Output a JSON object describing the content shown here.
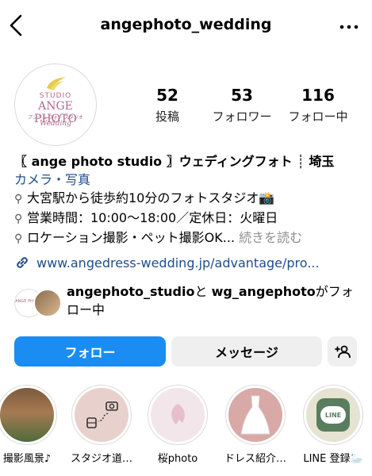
{
  "header": {
    "username": "angephoto_wedding"
  },
  "avatar": {
    "studio": "STUDIO",
    "ange": "ANGE PHOTO",
    "sub": "アンジェ フォト スタジオ",
    "wedding": "Wedding"
  },
  "stats": [
    {
      "value": "52",
      "label": "投稿"
    },
    {
      "value": "53",
      "label": "フォロワー"
    },
    {
      "value": "116",
      "label": "フォロー中"
    }
  ],
  "bio": {
    "line1_name": "〖 ange photo studio 〗ウェディングフォト ┊ 埼玉",
    "category": "カメラ・写真",
    "line2": "大宮駅から徒歩約10分のフォトスタジオ📸",
    "line3": "営業時間：10:00～18:00／定休日：火曜日",
    "line4": "ロケーション撮影・ペット撮影OK...",
    "more": " 続きを読む"
  },
  "link": {
    "url": "www.angedress-wedding.jp/advantage/pro..."
  },
  "mutual": {
    "user1": "angephoto_studio",
    "and": "と",
    "user2": "wg_angephoto",
    "suffix": "がフォロー中"
  },
  "buttons": {
    "follow": "フォロー",
    "message": "メッセージ"
  },
  "highlights": [
    {
      "label": "撮影風景♪"
    },
    {
      "label": "スタジオ道…"
    },
    {
      "label": "桜photo"
    },
    {
      "label": "ドレス紹介…"
    },
    {
      "label": "LINE 登録🦢"
    }
  ],
  "highlight_line_badge": "LINE"
}
